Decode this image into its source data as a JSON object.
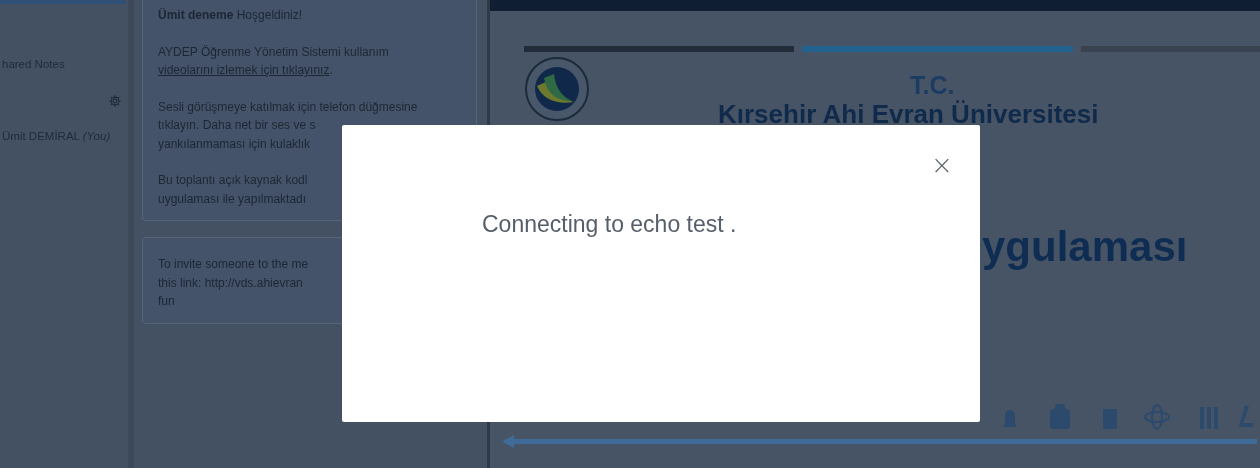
{
  "sidebar": {
    "notes_item": "hared Notes",
    "user": {
      "name": "Ümit DEMİRAL",
      "tag": "(You)"
    }
  },
  "chat": {
    "messages": [
      {
        "paragraphs": [
          {
            "kind": "rich",
            "text": "**Ümit deneme** Hoşgeldiniz!"
          },
          {
            "kind": "link",
            "text": "AYDEP Öğrenme Yönetim Sistemi kullanım",
            "link": "videolarını izlemek için tıklayınız",
            "after": "."
          },
          {
            "kind": "lines",
            "lines": [
              "Sesli görüşmeye katılmak için telefon düğmesine",
              "tıklayın. Daha net bir ses ve s",
              "yankılanmaması için kulaklık"
            ]
          },
          {
            "kind": "lines",
            "lines": [
              "Bu toplantı açık kaynak kodl",
              "uygulaması ile yapılmaktadı"
            ]
          }
        ]
      },
      {
        "paragraphs": [
          {
            "kind": "lines",
            "lines": [
              "To invite someone to the me",
              "this link: http://vds.ahievran",
              "fun"
            ]
          }
        ]
      }
    ]
  },
  "slide": {
    "heading": "T.C.",
    "university": "Kırsehir Ahi Evran Üniversitesi",
    "title_fragment": "ygulaması"
  },
  "modal": {
    "message": "Connecting to echo test .",
    "close": "×"
  }
}
